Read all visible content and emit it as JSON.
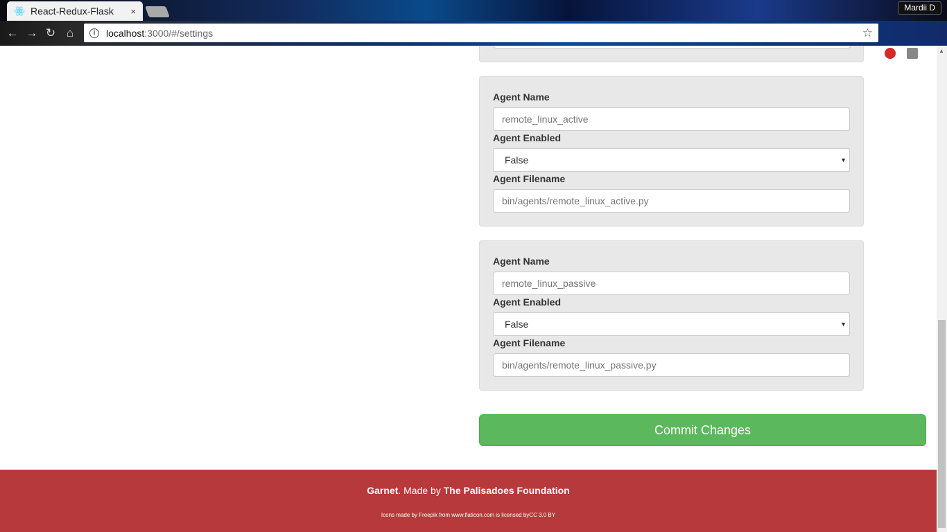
{
  "browser": {
    "tab_title": "React-Redux-Flask",
    "tab_close": "×",
    "profile_name": "Mardii D",
    "url_host": "localhost",
    "url_path": ":3000/#/settings"
  },
  "agents": [
    {
      "name_label": "Agent Name",
      "name_placeholder": "remote_linux_active",
      "enabled_label": "Agent Enabled",
      "enabled_value": "False",
      "filename_label": "Agent Filename",
      "filename_placeholder": "bin/agents/remote_linux_active.py"
    },
    {
      "name_label": "Agent Name",
      "name_placeholder": "remote_linux_passive",
      "enabled_label": "Agent Enabled",
      "enabled_value": "False",
      "filename_label": "Agent Filename",
      "filename_placeholder": "bin/agents/remote_linux_passive.py"
    }
  ],
  "commit_label": "Commit Changes",
  "footer": {
    "brand": "Garnet",
    "made_by": ". Made by ",
    "org": "The Palisadoes Foundation",
    "credits": "Icons made by Freepik from www.flaticon.com is licensed byCC 3.0 BY"
  },
  "colors": {
    "commit_green": "#5cb85c",
    "footer_red": "#b8393b"
  }
}
